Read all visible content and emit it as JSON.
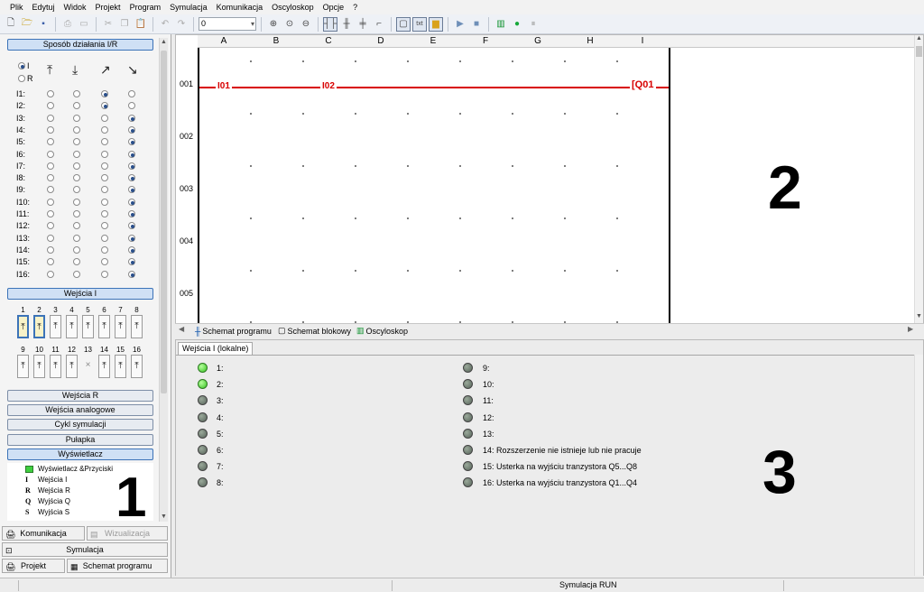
{
  "menu": [
    "Plik",
    "Edytuj",
    "Widok",
    "Projekt",
    "Program",
    "Symulacja",
    "Komunikacja",
    "Oscyloskop",
    "Opcje",
    "?"
  ],
  "toolbar": {
    "zoom_value": "0"
  },
  "left_panel": {
    "io_mode_header": "Sposób działania I/R",
    "mode_options": [
      "I",
      "R"
    ],
    "io_rows": [
      "I1:",
      "I2:",
      "I3:",
      "I4:",
      "I5:",
      "I6:",
      "I7:",
      "I8:",
      "I9:",
      "I10:",
      "I11:",
      "I12:",
      "I13:",
      "I14:",
      "I15:",
      "I16:"
    ],
    "inputs_header": "Wejścia I",
    "input_numbers_row1": [
      "1",
      "2",
      "3",
      "4",
      "5",
      "6",
      "7",
      "8"
    ],
    "input_numbers_row2": [
      "9",
      "10",
      "11",
      "12",
      "13",
      "14",
      "15",
      "16"
    ],
    "sections": [
      "Wejścia R",
      "Wejścia analogowe",
      "Cykl symulacji",
      "Pułapka"
    ],
    "display_header": "Wyświetlacz",
    "tree": [
      {
        "icon": "green-square",
        "label": "Wyświetlacz &Przyciski"
      },
      {
        "icon": "I",
        "label": "Wejścia I"
      },
      {
        "icon": "R",
        "label": "Wejścia R"
      },
      {
        "icon": "Q",
        "label": "Wyjścia Q"
      },
      {
        "icon": "S",
        "label": "Wyjścia S"
      }
    ],
    "big_label": "1",
    "buttons": {
      "communication": "Komunikacja",
      "visualization": "Wizualizacja",
      "simulation": "Symulacja",
      "project": "Projekt",
      "program_schema": "Schemat programu"
    }
  },
  "program": {
    "columns": [
      "A",
      "B",
      "C",
      "D",
      "E",
      "F",
      "G",
      "H",
      "I"
    ],
    "rows": [
      "001",
      "002",
      "003",
      "004",
      "005"
    ],
    "contacts": [
      "I01",
      "I02"
    ],
    "coil": "Q01",
    "big_label": "2"
  },
  "tabs": [
    "Schemat programu",
    "Schemat blokowy",
    "Oscyloskop"
  ],
  "bottom": {
    "tab": "Wejścia I (lokalne)",
    "left_leds": [
      {
        "label": "1:",
        "on": true
      },
      {
        "label": "2:",
        "on": true
      },
      {
        "label": "3:",
        "on": false
      },
      {
        "label": "4:",
        "on": false
      },
      {
        "label": "5:",
        "on": false
      },
      {
        "label": "6:",
        "on": false
      },
      {
        "label": "7:",
        "on": false
      },
      {
        "label": "8:",
        "on": false
      }
    ],
    "right_leds": [
      {
        "label": "9:",
        "on": false
      },
      {
        "label": "10:",
        "on": false
      },
      {
        "label": "11:",
        "on": false
      },
      {
        "label": "12:",
        "on": false
      },
      {
        "label": "13:",
        "on": false
      },
      {
        "label": "14:   Rozszerzenie nie istnieje lub nie pracuje",
        "on": false
      },
      {
        "label": "15:   Usterka na wyjściu tranzystora Q5...Q8",
        "on": false
      },
      {
        "label": "16:   Usterka na wyjściu tranzystora Q1...Q4",
        "on": false
      }
    ],
    "big_label": "3"
  },
  "status": {
    "center": "Symulacja RUN"
  }
}
